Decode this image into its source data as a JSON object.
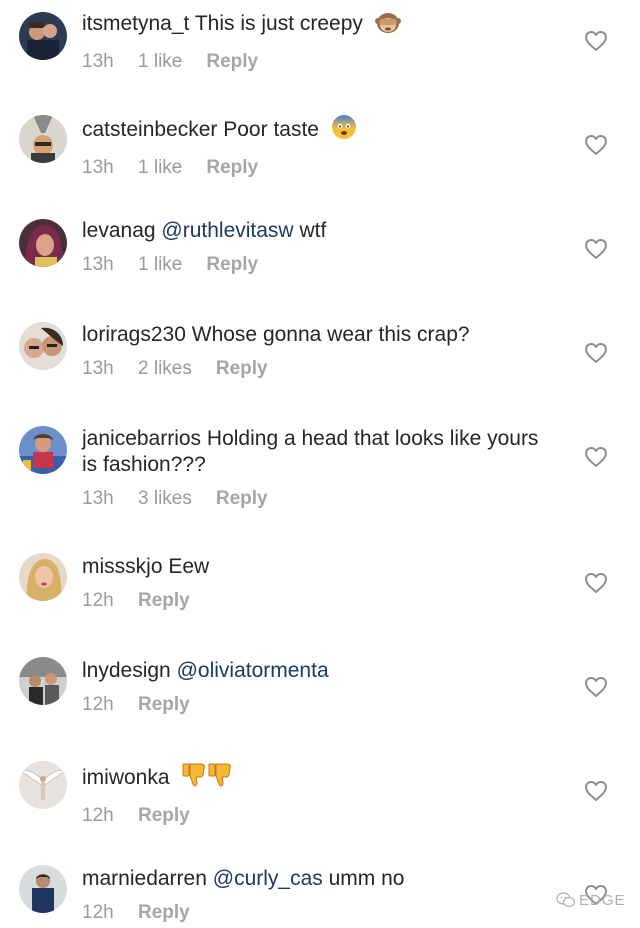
{
  "comments": [
    {
      "username": "itsmetyna_t",
      "text": "This is just creepy",
      "mention": "",
      "tail": "",
      "emoji": "see-no-evil-monkey",
      "time": "13h",
      "likes": "1 like",
      "reply": "Reply"
    },
    {
      "username": "catsteinbecker",
      "text": "Poor taste",
      "mention": "",
      "tail": "",
      "emoji": "fearful-face",
      "time": "13h",
      "likes": "1 like",
      "reply": "Reply"
    },
    {
      "username": "levanag",
      "text": "",
      "mention": "@ruthlevitasw",
      "tail": "wtf",
      "emoji": "",
      "time": "13h",
      "likes": "1 like",
      "reply": "Reply"
    },
    {
      "username": "lorirags230",
      "text": "Whose gonna wear this crap?",
      "mention": "",
      "tail": "",
      "emoji": "",
      "time": "13h",
      "likes": "2 likes",
      "reply": "Reply"
    },
    {
      "username": "janicebarrios",
      "text": "Holding a head that looks like yours is fashion???",
      "mention": "",
      "tail": "",
      "emoji": "",
      "time": "13h",
      "likes": "3 likes",
      "reply": "Reply"
    },
    {
      "username": "missskjo",
      "text": "Eew",
      "mention": "",
      "tail": "",
      "emoji": "",
      "time": "12h",
      "likes": "",
      "reply": "Reply"
    },
    {
      "username": "lnydesign",
      "text": "",
      "mention": "@oliviatormenta",
      "tail": "",
      "emoji": "",
      "time": "12h",
      "likes": "",
      "reply": "Reply"
    },
    {
      "username": "imiwonka",
      "text": "",
      "mention": "",
      "tail": "",
      "emoji": "thumbs-down-x2",
      "time": "12h",
      "likes": "",
      "reply": "Reply"
    },
    {
      "username": "marniedarren",
      "text": "",
      "mention": "@curly_cas",
      "tail": "umm no",
      "emoji": "",
      "time": "12h",
      "likes": "",
      "reply": "Reply"
    }
  ],
  "watermark": {
    "text": "EDGE",
    "icon": "wechat-icon"
  },
  "colors": {
    "text": "#262626",
    "meta": "#9a9a9a",
    "mention": "#1b3a62",
    "heart_stroke": "#8e8e8e"
  }
}
